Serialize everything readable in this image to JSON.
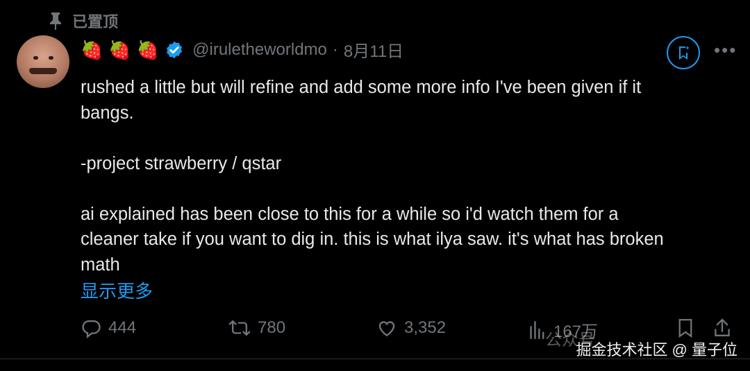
{
  "pinned": {
    "label": "已置顶"
  },
  "author": {
    "emojis": [
      "🍓",
      "🍓",
      "🍓"
    ],
    "handle": "@iruletheworldmo",
    "separator": "·",
    "date": "8月11日"
  },
  "tweet": {
    "lines": [
      "rushed a little but will refine and add some more info I've been given if it",
      "bangs.",
      "",
      "-project strawberry / qstar",
      "",
      "ai explained has been close to this for a while so i'd watch them for a",
      "cleaner take if you want to dig in. this is what ilya saw. it's what has broken",
      "math"
    ],
    "show_more": "显示更多"
  },
  "stats": {
    "replies": "444",
    "reposts": "780",
    "likes": "3,352",
    "views": "167万"
  },
  "watermark": {
    "main": "掘金技术社区 @ 量子位",
    "faint": "公众号"
  },
  "colors": {
    "accent": "#1d9bf0",
    "muted": "#71767b",
    "text": "#e7e9ea",
    "background": "#000000"
  }
}
